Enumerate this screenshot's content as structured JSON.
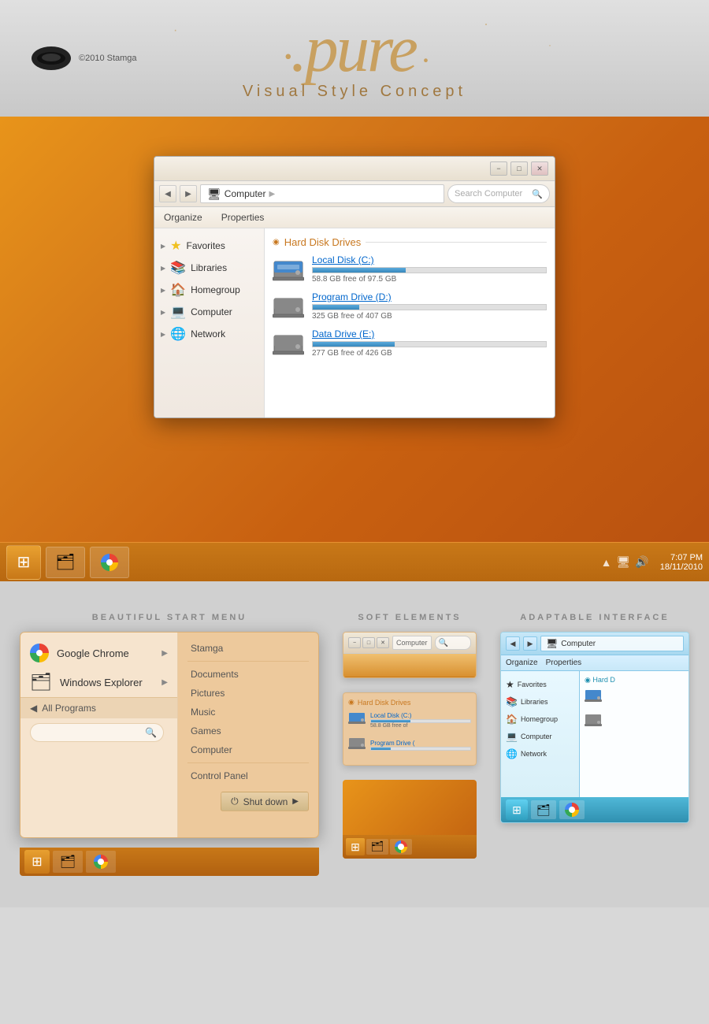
{
  "header": {
    "title": ".pure",
    "subtitle": "Visual Style Concept",
    "copyright": "©2010 Stamga"
  },
  "desktop": {
    "explorer": {
      "title": "Computer",
      "search_placeholder": "Search Computer",
      "toolbar_items": [
        "Organize",
        "Properties"
      ],
      "nav": {
        "back": "<",
        "forward": ">"
      },
      "sidebar": {
        "items": [
          {
            "label": "Favorites",
            "icon": "★"
          },
          {
            "label": "Libraries",
            "icon": "📚"
          },
          {
            "label": "Homegroup",
            "icon": "🏠"
          },
          {
            "label": "Computer",
            "icon": "💻"
          },
          {
            "label": "Network",
            "icon": "🌐"
          }
        ]
      },
      "drives": {
        "section": "Hard Disk Drives",
        "items": [
          {
            "name": "Local Disk (C:)",
            "free": "58.8 GB free of 97.5 GB",
            "fill_pct": 40
          },
          {
            "name": "Program Drive (D:)",
            "free": "325 GB free of 407 GB",
            "fill_pct": 20
          },
          {
            "name": "Data Drive (E:)",
            "free": "277 GB free of 426 GB",
            "fill_pct": 35
          }
        ]
      }
    },
    "taskbar": {
      "time": "7:07 PM",
      "date": "18/11/2010"
    }
  },
  "features": {
    "start_menu": {
      "title": "BEAUTIFUL START MENU",
      "left_items": [
        {
          "label": "Google Chrome",
          "icon": "chrome"
        },
        {
          "label": "Windows Explorer",
          "icon": "explorer"
        }
      ],
      "right_items": [
        {
          "label": "Stamga"
        },
        {
          "label": "Documents"
        },
        {
          "label": "Pictures"
        },
        {
          "label": "Music"
        },
        {
          "label": "Games"
        },
        {
          "label": "Computer"
        },
        {
          "label": "Control Panel"
        }
      ],
      "all_programs": "All Programs",
      "shutdown": "Shut down",
      "search_placeholder": ""
    },
    "soft_elements": {
      "title": "SOFT ELEMENTS",
      "address": "Computer",
      "drives_section": "Hard Disk Drives",
      "drive_items": [
        {
          "name": "Local Disk (C:)",
          "free": "58.8 GB free of",
          "fill_pct": 40
        },
        {
          "name": "Program Drive (",
          "free": "",
          "fill_pct": 20
        }
      ]
    },
    "adaptable": {
      "title": "ADAPTABLE INTERFACE",
      "address": "Computer",
      "toolbar_items": [
        "Organize",
        "Properties"
      ],
      "sidebar_items": [
        {
          "label": "Favorites",
          "icon": "★"
        },
        {
          "label": "Libraries",
          "icon": "📚"
        },
        {
          "label": "Homegroup",
          "icon": "🏠"
        },
        {
          "label": "Computer",
          "icon": "💻"
        },
        {
          "label": "Network",
          "icon": "🌐"
        }
      ],
      "section": "Hard D",
      "drives": [
        {
          "icon": "💾"
        }
      ]
    }
  }
}
